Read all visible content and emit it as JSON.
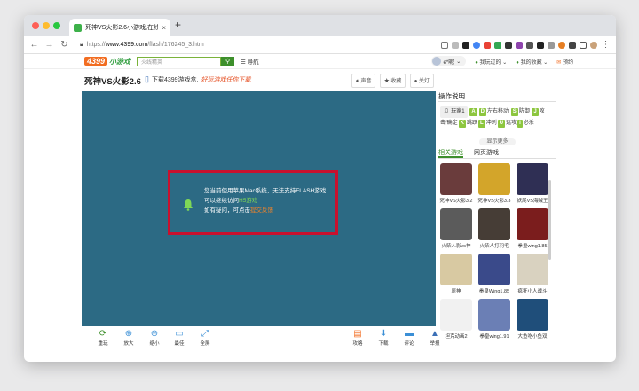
{
  "browser": {
    "tab_title": "死神VS火影2.6小游戏,在线玩,4",
    "tab_close": "×",
    "new_tab": "+",
    "url_prefix": "https://",
    "url_domain": "www.4399.com",
    "url_path": "/flash/176245_3.htm"
  },
  "site": {
    "logo": "4399",
    "logo_sub": "小游戏",
    "search_placeholder": "火线精英",
    "nav_label": "导航",
    "user_name": "e*昵",
    "my_games": "我玩过的",
    "favorites": "我的收藏",
    "checkin": "预约"
  },
  "title_row": {
    "game_title": "死神VS火影2.6",
    "promo_text": "下载4399游戏盒,",
    "promo_highlight": "好玩游戏任你下载",
    "actions": [
      "声音",
      "收藏",
      "关灯"
    ]
  },
  "notice": {
    "line1": "您当前使用苹果Mac系统，无法支持FLASH游戏",
    "line2_prefix": "可以继续访问",
    "line2_link": "H5游戏",
    "line3_prefix": "如有疑问，可点击",
    "line3_link": "提交反馈"
  },
  "side": {
    "heading": "操作说明",
    "player1": "玩家1",
    "keys_move": [
      "A",
      "D"
    ],
    "move_label": "左右移动",
    "key_defend": "S",
    "defend_label": "防御",
    "key_attack": "J",
    "attack_label": "攻",
    "line2_a": "击/确定",
    "key_k": "K",
    "jump_label": "跳跃",
    "key_l": "L",
    "dash_label": "冲刺",
    "key_u": "U",
    "long_label": "远攻",
    "key_i": "I",
    "special_label": "必杀",
    "show_more": "显示更多",
    "tab_related": "相关游戏",
    "tab_web": "网页游戏",
    "games": [
      {
        "name": "死神VS火影3.2",
        "color": "#6a3c3c"
      },
      {
        "name": "死神VS火影3.3",
        "color": "#d3a52a"
      },
      {
        "name": "妖尾VS海贼王",
        "color": "#2f2f54"
      },
      {
        "name": "火柴人影vs神",
        "color": "#5b5b5b"
      },
      {
        "name": "火柴人打羽毛",
        "color": "#463d36"
      },
      {
        "name": "拳皇wing1.85",
        "color": "#7b1d1d"
      },
      {
        "name": "原神",
        "color": "#d8c9a2"
      },
      {
        "name": "拳皇Wing1.85",
        "color": "#3a4a8a"
      },
      {
        "name": "疯狂小人战斗",
        "color": "#d9d2c0"
      },
      {
        "name": "坦克动画2",
        "color": "#f1f1f1"
      },
      {
        "name": "拳皇wing1.91",
        "color": "#6b7fb5"
      },
      {
        "name": "大鱼吃小鱼双",
        "color": "#1f4e7a"
      }
    ]
  },
  "bottom": {
    "left": [
      {
        "label": "重玩",
        "icon": "refresh-icon"
      },
      {
        "label": "放大",
        "icon": "zoom-in-icon"
      },
      {
        "label": "缩小",
        "icon": "zoom-out-icon"
      },
      {
        "label": "最佳",
        "icon": "fit-icon"
      },
      {
        "label": "全屏",
        "icon": "fullscreen-icon"
      }
    ],
    "right": [
      {
        "label": "攻略",
        "icon": "guide-icon"
      },
      {
        "label": "下载",
        "icon": "download-icon"
      },
      {
        "label": "评论",
        "icon": "comment-icon"
      },
      {
        "label": "举报",
        "icon": "report-icon"
      }
    ]
  },
  "colors": {
    "game_bg": "#2c6a84",
    "notice_border": "#c8102e",
    "brand_green": "#3d8f2b",
    "key_green": "#8dc63f"
  }
}
